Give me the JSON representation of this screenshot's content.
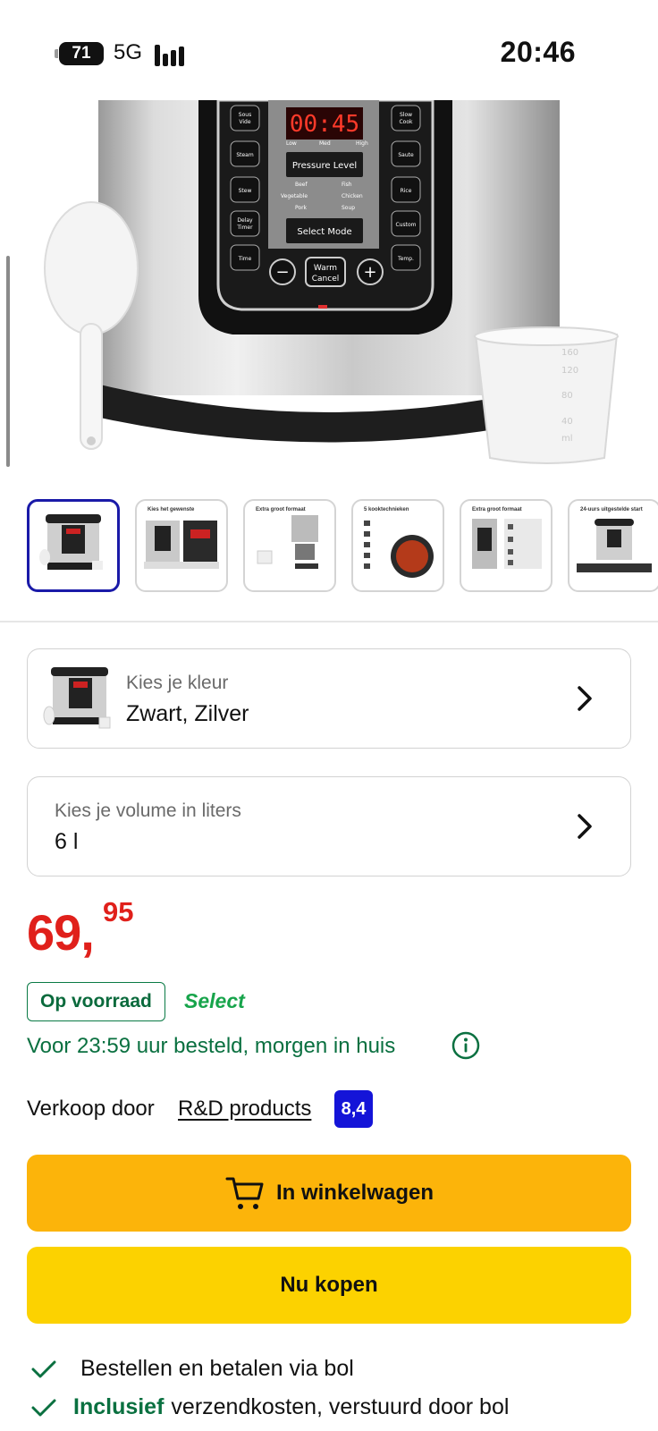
{
  "status_bar": {
    "battery": "71",
    "network": "5G",
    "time": "20:46"
  },
  "gallery": {
    "thumbnails": [
      {
        "title": ""
      },
      {
        "title": "Kies het gewenste"
      },
      {
        "title": "Extra groot formaat"
      },
      {
        "title": "5 kooktechnieken"
      },
      {
        "title": "Extra groot formaat"
      },
      {
        "title": "24-uurs uitgestelde start"
      }
    ],
    "hero_panel": {
      "display": "00:45",
      "buttons_left": [
        "Sous Vide",
        "Steam",
        "Stew",
        "Delay Timer",
        "Time"
      ],
      "buttons_right": [
        "Slow Cook",
        "Saute",
        "Rice",
        "Custom",
        "Temp."
      ],
      "pressure_labels": [
        "Low",
        "Med",
        "High"
      ],
      "pressure_button": "Pressure Level",
      "modes": [
        "Beef",
        "Fish",
        "Vegetable",
        "Chicken",
        "Pork",
        "Soup"
      ],
      "select_button": "Select Mode",
      "warm_button": "Warm Cancel"
    }
  },
  "color_selector": {
    "label": "Kies je kleur",
    "value": "Zwart, Zilver"
  },
  "volume_selector": {
    "label": "Kies je volume in liters",
    "value": "6 l"
  },
  "price": {
    "euros": "69,",
    "cents": "95",
    "color": "#e0201b"
  },
  "availability": {
    "stock": "Op voorraad",
    "select": "Select",
    "delivery": "Voor 23:59 uur besteld, morgen in huis"
  },
  "seller": {
    "prefix": "Verkoop door",
    "name": "R&D products",
    "rating": "8,4"
  },
  "actions": {
    "cart_label": "In winkelwagen",
    "buy_label": "Nu kopen"
  },
  "usps": [
    {
      "bold": "",
      "text": "Bestellen en betalen via bol"
    },
    {
      "bold": "Inclusief",
      "text": "verzendkosten, verstuurd door bol"
    }
  ],
  "colors": {
    "cart_button": "#fcb40a",
    "buy_button": "#fcd200",
    "green": "#0a7040",
    "rating_blue": "#1414d8"
  }
}
